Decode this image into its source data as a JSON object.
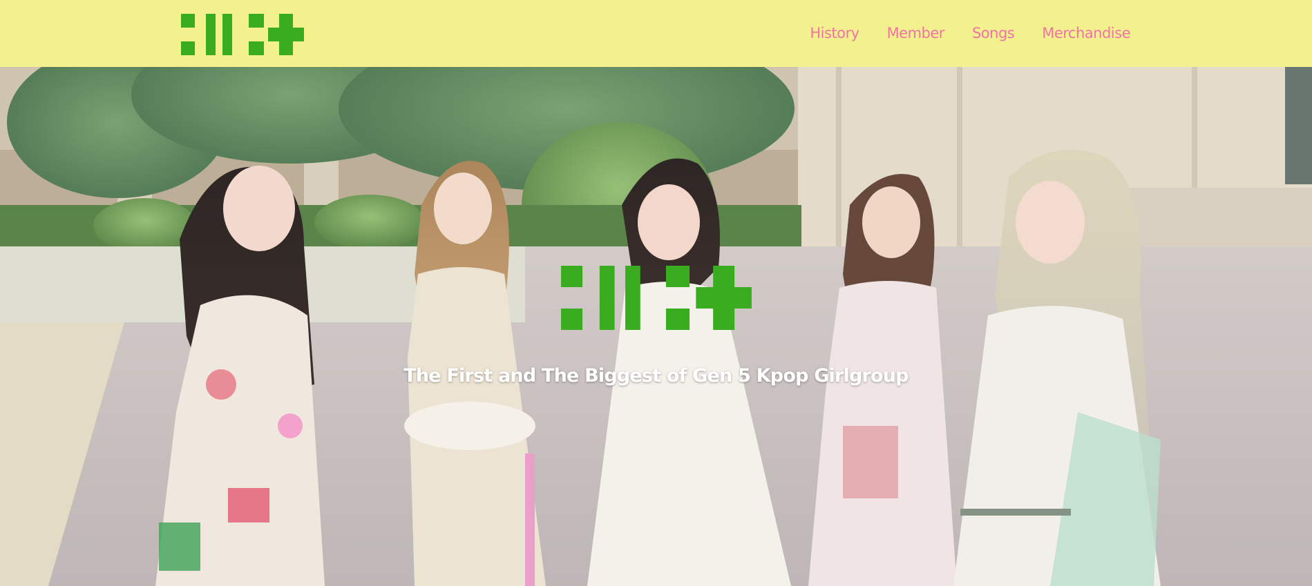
{
  "colors": {
    "header_bg": "#f3f08e",
    "nav_text": "#f173a6",
    "logo_green": "#3aac1f",
    "tagline_text": "#ffffff"
  },
  "header": {
    "logo_icon": "group-logo-icon",
    "nav": [
      {
        "label": "History"
      },
      {
        "label": "Member"
      },
      {
        "label": "Songs"
      },
      {
        "label": "Merchandise"
      }
    ]
  },
  "hero": {
    "photo": "group-photo",
    "logo_icon": "group-logo-icon",
    "tagline": "The First and The Biggest of Gen 5 Kpop Girlgroup"
  }
}
